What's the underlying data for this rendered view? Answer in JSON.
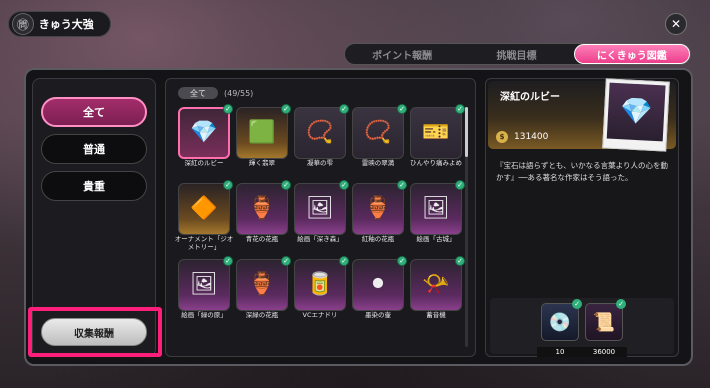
{
  "header": {
    "title": "きゅう大強",
    "logo_glyph": "㉄",
    "close_glyph": "✕"
  },
  "tabs": [
    {
      "label": "ポイント報酬",
      "active": false
    },
    {
      "label": "挑戦目標",
      "active": false
    },
    {
      "label": "にくきゅう図鑑",
      "active": true
    }
  ],
  "filters": [
    {
      "label": "全て",
      "active": true
    },
    {
      "label": "普通",
      "active": false
    },
    {
      "label": "貴重",
      "active": false
    }
  ],
  "reward_button": {
    "label": "収集報酬"
  },
  "grid": {
    "filter_label": "全て",
    "count": "(49/55)",
    "items": [
      {
        "name": "深紅のルビー",
        "icon": "💎",
        "tone": "selected",
        "checked": true
      },
      {
        "name": "輝く翡翠",
        "icon": "🟩",
        "tone": "gold",
        "checked": true
      },
      {
        "name": "凝華の雫",
        "icon": "📿",
        "tone": "plain",
        "checked": true
      },
      {
        "name": "雷映の翠満",
        "icon": "📿",
        "tone": "plain",
        "checked": true
      },
      {
        "name": "ひんやり痛みよめ",
        "icon": "🎫",
        "tone": "plain",
        "checked": true
      },
      {
        "name": "オーナメント「ジオメトリー」",
        "icon": "🔶",
        "tone": "gold",
        "checked": true
      },
      {
        "name": "青花の花瓶",
        "icon": "🏺",
        "tone": "purple",
        "checked": true
      },
      {
        "name": "絵画「深き森」",
        "icon": "🖼",
        "tone": "purple",
        "checked": true
      },
      {
        "name": "紅釉の花瓶",
        "icon": "🏺",
        "tone": "purple",
        "checked": true
      },
      {
        "name": "絵画「古城」",
        "icon": "🖼",
        "tone": "purple",
        "checked": true
      },
      {
        "name": "絵画「緑の原」",
        "icon": "🖼",
        "tone": "purple",
        "checked": true
      },
      {
        "name": "深緑の花瓶",
        "icon": "🏺",
        "tone": "purple",
        "checked": true
      },
      {
        "name": "VCエナドリ",
        "icon": "🥫",
        "tone": "purple",
        "checked": true
      },
      {
        "name": "墨染の壷",
        "icon": "⚫",
        "tone": "purple",
        "checked": true
      },
      {
        "name": "蓄音機",
        "icon": "📯",
        "tone": "purple",
        "checked": true
      }
    ]
  },
  "detail": {
    "name": "深紅のルビー",
    "price": "131400",
    "description": "『宝石は語らずとも、いかなる言葉より人の心を動かす』──ある著名な作家はそう語った。",
    "art_icon": "💎",
    "rewards": [
      {
        "icon": "💿",
        "qty": "10"
      },
      {
        "icon": "📜",
        "qty": "36000"
      }
    ]
  }
}
